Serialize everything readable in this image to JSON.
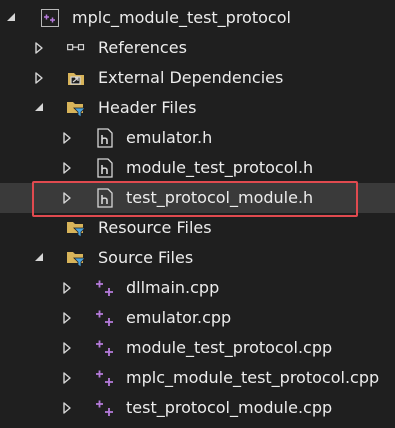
{
  "colors": {
    "background": "#1f1f1f",
    "text": "#ececec",
    "selected_row": "#3a3a3a",
    "highlight_border": "#e04a4f",
    "project_icon": "#b67bdc",
    "cpp_icon": "#b67bdc",
    "folder": "#d8b45a",
    "filter_funnel": "#4aa3df"
  },
  "tree": {
    "project": {
      "label": "mplc_module_test_protocol",
      "icon": "vc-project-icon"
    },
    "references": {
      "label": "References",
      "icon": "references-icon"
    },
    "external_dependencies": {
      "label": "External Dependencies",
      "icon": "external-dependencies-icon"
    },
    "header_files": {
      "label": "Header Files",
      "icon": "filter-folder-icon",
      "items": [
        {
          "label": "emulator.h",
          "icon": "header-file-icon"
        },
        {
          "label": "module_test_protocol.h",
          "icon": "header-file-icon"
        },
        {
          "label": "test_protocol_module.h",
          "icon": "header-file-icon"
        }
      ]
    },
    "resource_files": {
      "label": "Resource Files",
      "icon": "filter-folder-icon"
    },
    "source_files": {
      "label": "Source Files",
      "icon": "filter-folder-icon",
      "items": [
        {
          "label": "dllmain.cpp",
          "icon": "cpp-file-icon"
        },
        {
          "label": "emulator.cpp",
          "icon": "cpp-file-icon"
        },
        {
          "label": "module_test_protocol.cpp",
          "icon": "cpp-file-icon"
        },
        {
          "label": "mplc_module_test_protocol.cpp",
          "icon": "cpp-file-icon"
        },
        {
          "label": "test_protocol_module.cpp",
          "icon": "cpp-file-icon"
        }
      ]
    }
  }
}
